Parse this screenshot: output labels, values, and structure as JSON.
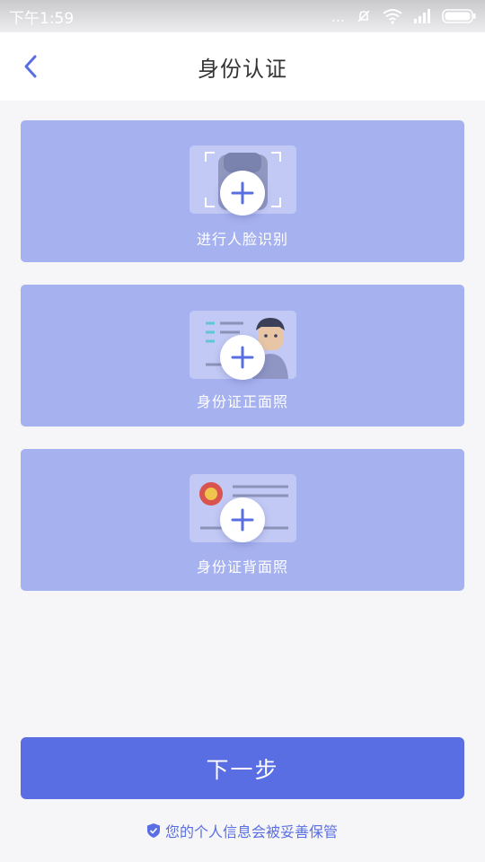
{
  "status_bar": {
    "time": "下午1:59",
    "dots": "...",
    "battery_icon": "battery-icon"
  },
  "header": {
    "title": "身份认证",
    "back_icon": "chevron-left-icon"
  },
  "cards": [
    {
      "label": "进行人脸识别",
      "icon": "face-scan-icon"
    },
    {
      "label": "身份证正面照",
      "icon": "id-card-front-icon"
    },
    {
      "label": "身份证背面照",
      "icon": "id-card-back-icon"
    }
  ],
  "next_button": {
    "label": "下一步"
  },
  "footer": {
    "note": "您的个人信息会被妥善保管",
    "icon": "shield-icon"
  },
  "colors": {
    "accent": "#5a6ee3",
    "card_bg": "#a6b1ef",
    "page_bg": "#f6f6f8"
  }
}
